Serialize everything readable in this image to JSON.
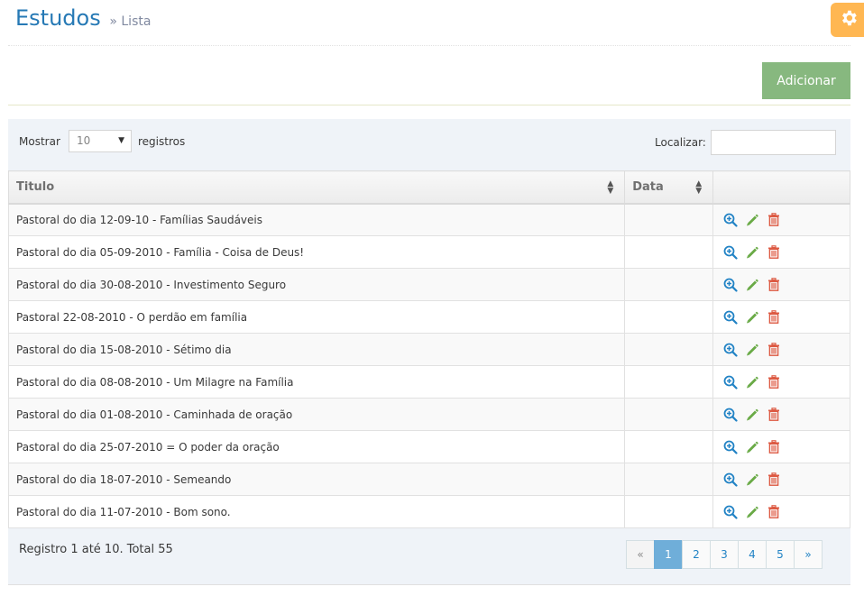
{
  "header": {
    "title": "Estudos",
    "subtitle": "» Lista"
  },
  "toolbar": {
    "add_label": "Adicionar"
  },
  "controls": {
    "show_label": "Mostrar",
    "page_size": "10",
    "records_label": "registros",
    "search_label": "Localizar:",
    "search_value": ""
  },
  "table": {
    "columns": [
      "Titulo",
      "Data",
      ""
    ],
    "rows": [
      {
        "title": "Pastoral do dia 12-09-10 - Famílias Saudáveis",
        "date": ""
      },
      {
        "title": "Pastoral do dia 05-09-2010 - Família - Coisa de Deus!",
        "date": ""
      },
      {
        "title": "Pastoral do dia 30-08-2010 - Investimento Seguro",
        "date": ""
      },
      {
        "title": "Pastoral 22-08-2010 - O perdão em família",
        "date": ""
      },
      {
        "title": "Pastoral do dia 15-08-2010 - Sétimo dia",
        "date": ""
      },
      {
        "title": "Pastoral do dia 08-08-2010 - Um Milagre na Família",
        "date": ""
      },
      {
        "title": "Pastoral do dia 01-08-2010 - Caminhada de oração",
        "date": ""
      },
      {
        "title": "Pastoral do dia 25-07-2010 = O poder da oração",
        "date": ""
      },
      {
        "title": "Pastoral do dia 18-07-2010 - Semeando",
        "date": ""
      },
      {
        "title": "Pastoral do dia 11-07-2010 - Bom sono.",
        "date": ""
      }
    ]
  },
  "footer": {
    "info": "Registro 1 até 10. Total 55",
    "pages": [
      "«",
      "1",
      "2",
      "3",
      "4",
      "5",
      "»"
    ],
    "active_page": "1"
  },
  "colors": {
    "title": "#2679b5",
    "add_button": "#87b87f",
    "settings_button": "#ffb752",
    "view_icon": "#2283c5",
    "edit_icon": "#69aa46",
    "delete_icon": "#dd5a43",
    "active_page": "#6faed9"
  },
  "icons": {
    "settings": "gear-icon",
    "view": "zoom-in-icon",
    "edit": "pencil-icon",
    "delete": "trash-icon"
  }
}
